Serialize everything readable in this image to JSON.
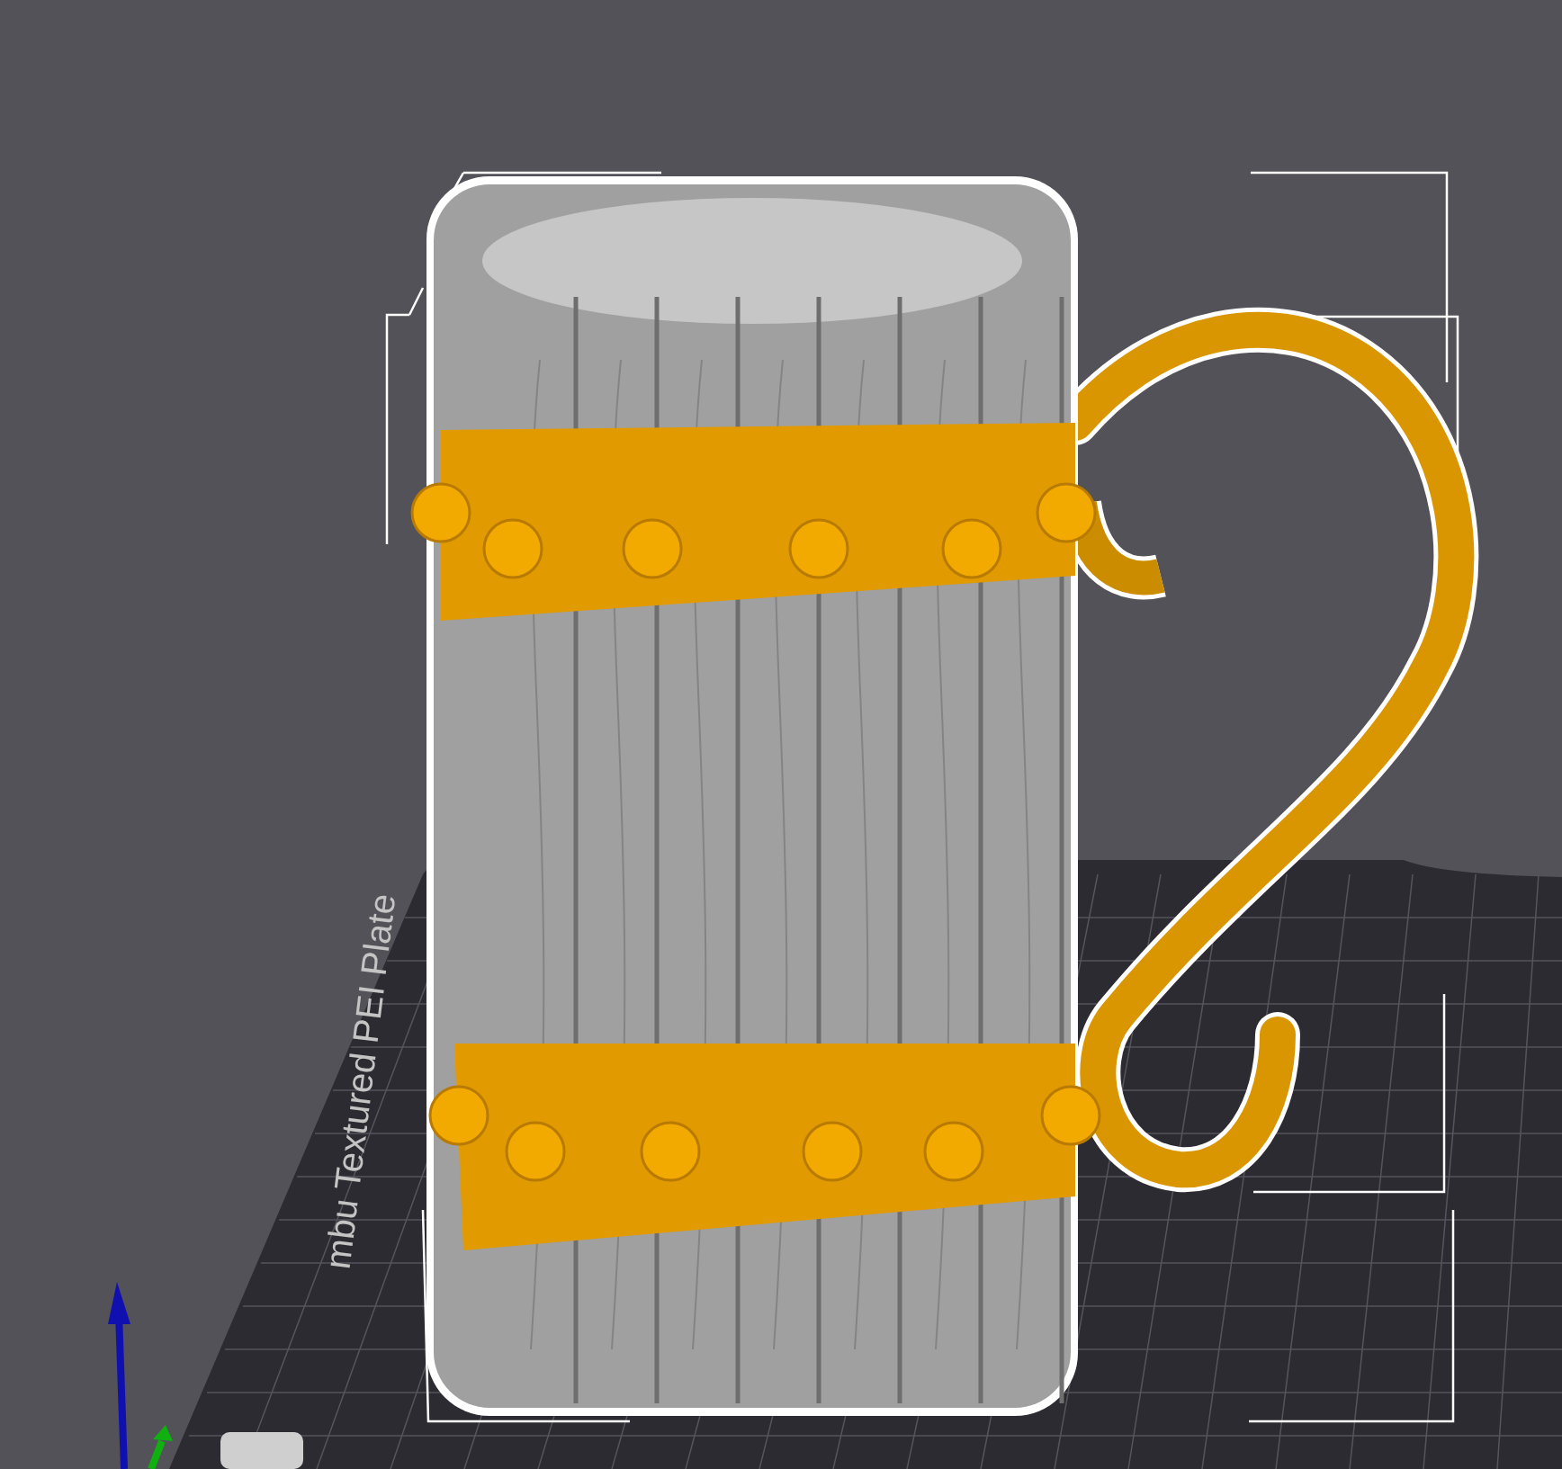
{
  "viewport": {
    "plate_label": "mbu Textured PEI Plate"
  }
}
